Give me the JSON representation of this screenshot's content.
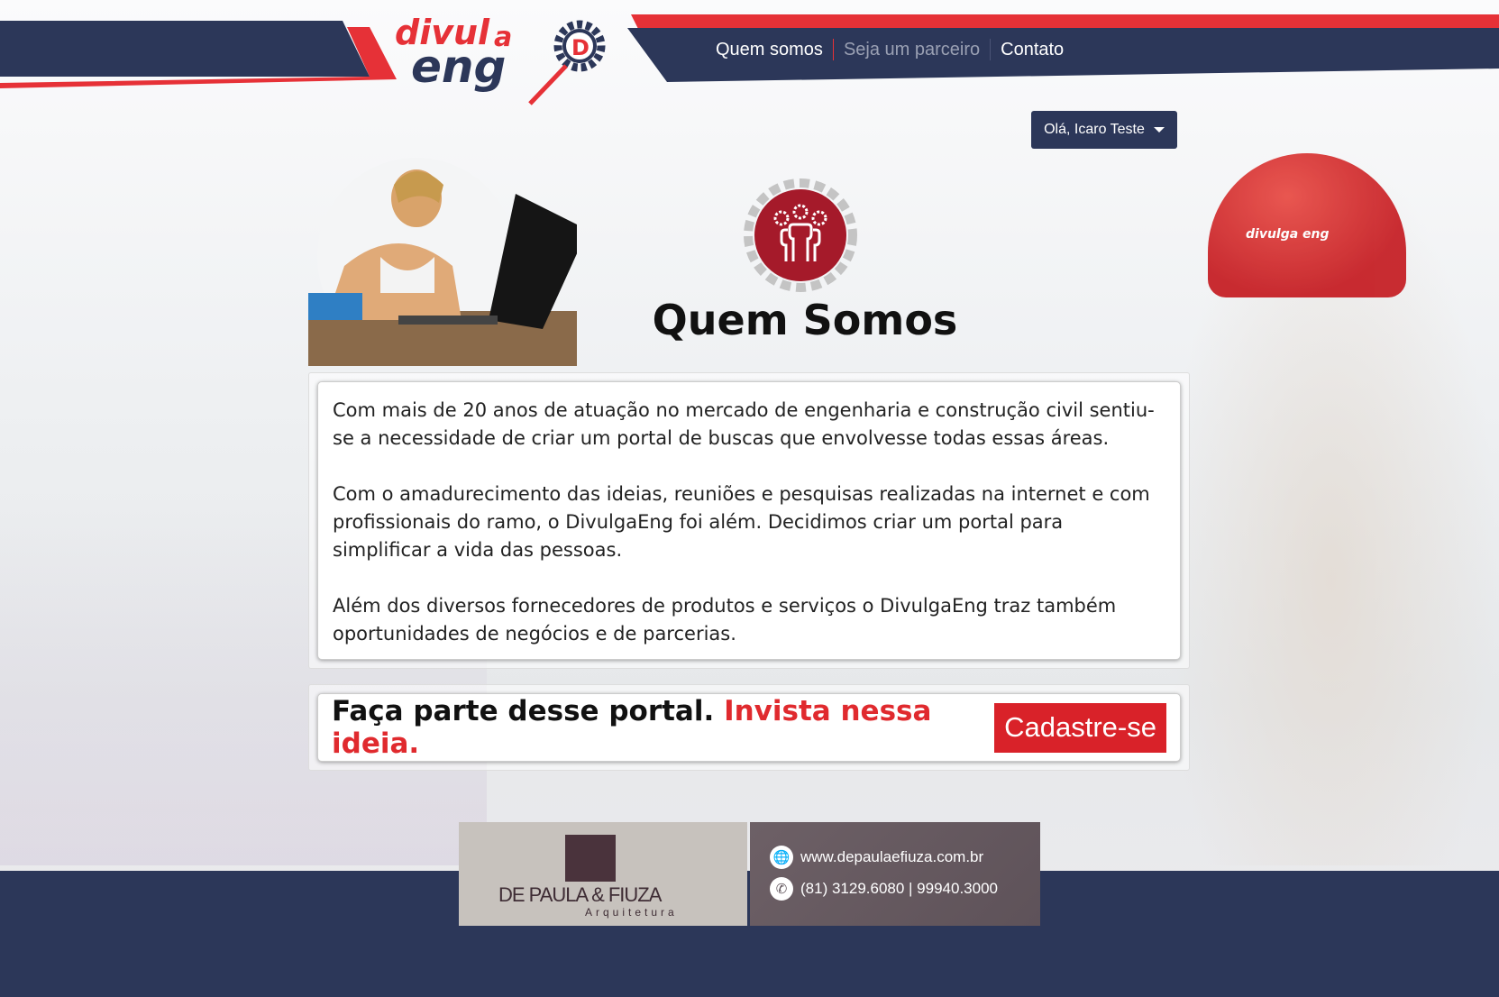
{
  "header": {
    "logo_text": "divulga eng",
    "nav": [
      {
        "label": "Quem somos"
      },
      {
        "label": "Seja um parceiro"
      },
      {
        "label": "Contato"
      }
    ],
    "user_menu": "Olá, Icaro Teste"
  },
  "helmet_logo": "divulga eng",
  "main": {
    "title": "Quem Somos",
    "paragraphs": [
      "Com mais de 20 anos de atuação no mercado de engenharia e construção civil sentiu-se a necessidade de criar um portal de buscas que envolvesse todas essas áreas.",
      "Com o amadurecimento das ideias, reuniões e pesquisas realizadas na internet e com profissionais do ramo, o DivulgaEng foi além. Decidimos criar um portal para simplificar a vida das pessoas.",
      "Além dos diversos fornecedores de produtos e serviços o DivulgaEng traz também oportunidades de negócios e de parcerias."
    ],
    "cta_text": "Faça parte desse portal.",
    "cta_highlight": "Invista nessa ideia.",
    "cta_button": "Cadastre-se"
  },
  "sponsor": {
    "name": "DE PAULA & FIUZA",
    "subtitle": "Arquitetura",
    "website": "www.depaulaefiuza.com.br",
    "phone": "(81) 3129.6080 | 99940.3000"
  },
  "colors": {
    "navy": "#2c3759",
    "red": "#e63137",
    "icon_red": "#a51a2a"
  }
}
